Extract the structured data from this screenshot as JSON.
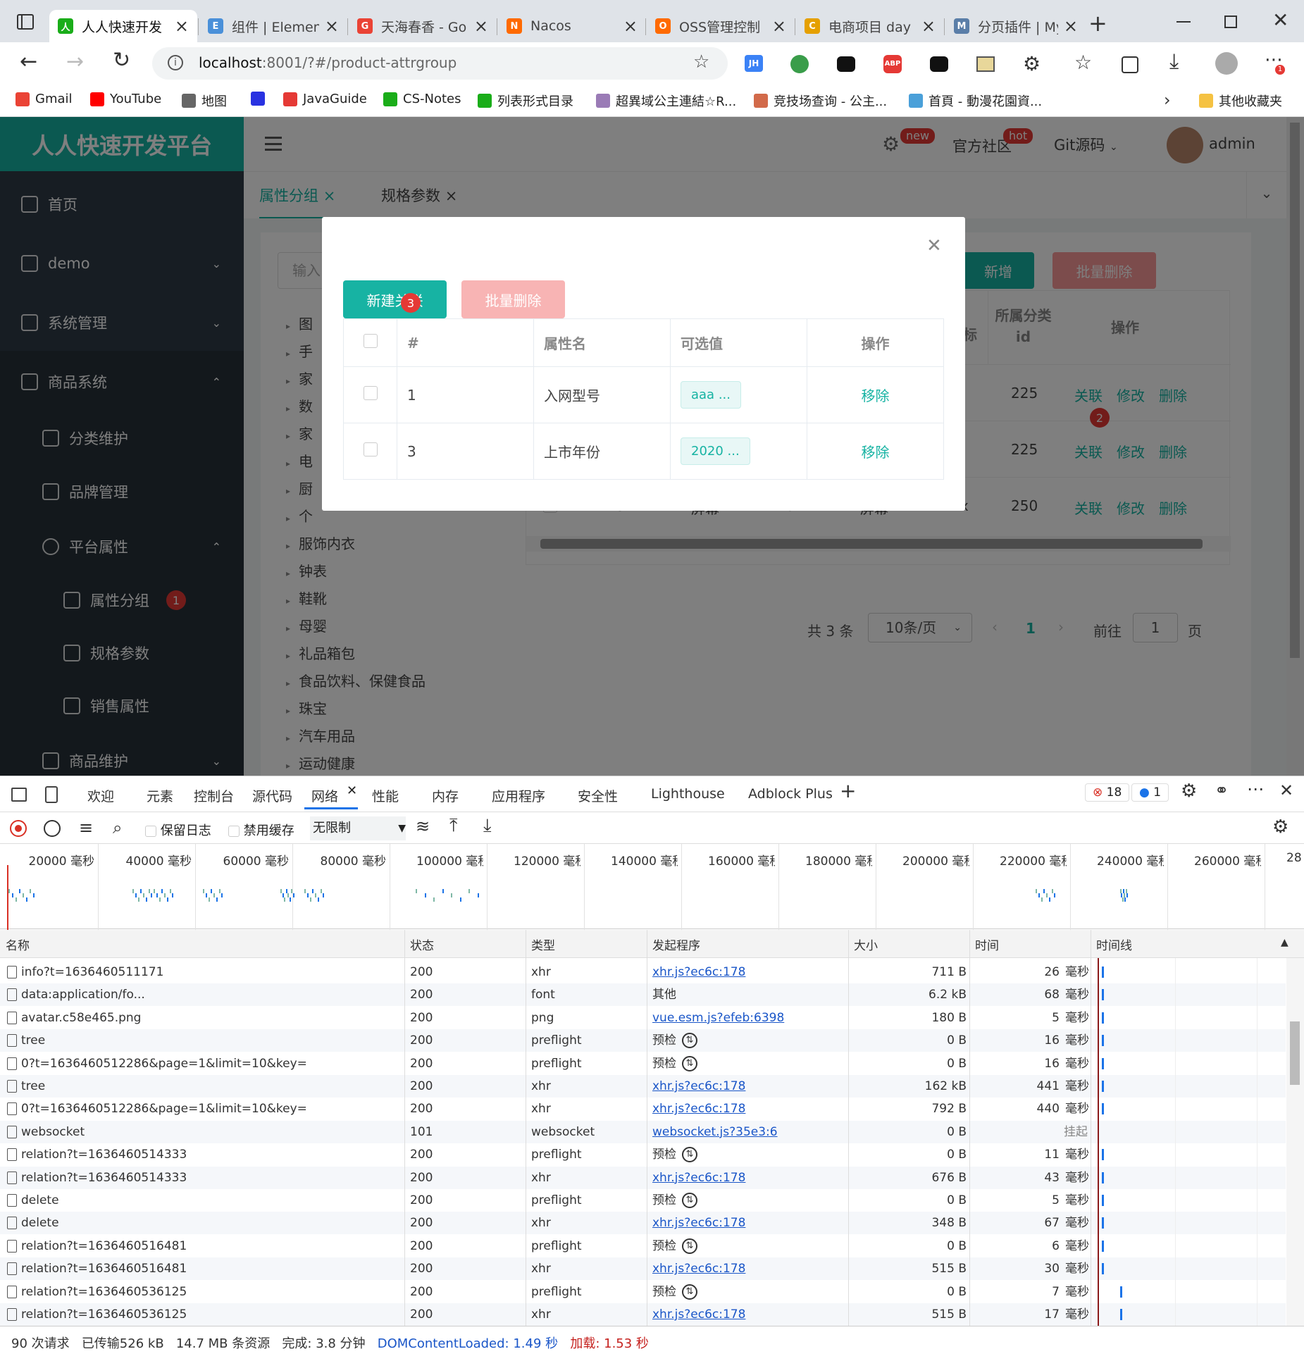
{
  "tabs": [
    {
      "label": "人人快速开发",
      "color": "#1aad19",
      "glyph": "人"
    },
    {
      "label": "组件 | Elemen",
      "color": "#4a90d9",
      "glyph": "E"
    },
    {
      "label": "天海春香 - Go",
      "color": "#ea4335",
      "glyph": "G"
    },
    {
      "label": "Nacos",
      "color": "#ff6a00",
      "glyph": "N"
    },
    {
      "label": "OSS管理控制",
      "color": "#ff6a00",
      "glyph": "O"
    },
    {
      "label": "电商项目 day",
      "color": "#e5a000",
      "glyph": "C"
    },
    {
      "label": "分页插件 | My",
      "color": "#5a7ea8",
      "glyph": "M"
    }
  ],
  "address": {
    "host": "localhost",
    "rest": ":8001/?#/product-attrgroup"
  },
  "bookmarks": [
    {
      "label": "Gmail",
      "color": "#ea4335"
    },
    {
      "label": "YouTube",
      "color": "#ff0000"
    },
    {
      "label": "地图",
      "color": "#666666"
    },
    {
      "label": "",
      "color": "#2932e1"
    },
    {
      "label": "JavaGuide",
      "color": "#e53935"
    },
    {
      "label": "CS-Notes",
      "color": "#1aad19"
    },
    {
      "label": "列表形式目录",
      "color": "#1aad19"
    },
    {
      "label": "超異域公主連結☆R...",
      "color": "#9a7bb6"
    },
    {
      "label": "竞技场查询 - 公主...",
      "color": "#d26a4a"
    },
    {
      "label": "首頁 - 動漫花園資...",
      "color": "#4aa0d9"
    }
  ],
  "bookmarks_other": "其他收藏夹",
  "app": {
    "logo": "人人快速开发平台",
    "header": {
      "new_badge": "new",
      "hot_badge": "hot",
      "community": "官方社区",
      "git": "Git源码",
      "user": "admin"
    },
    "menu": {
      "home": "首页",
      "demo": "demo",
      "sys": "系统管理",
      "product": "商品系统",
      "category": "分类维护",
      "brand": "品牌管理",
      "platform": "平台属性",
      "attrgroup": "属性分组",
      "spec": "规格参数",
      "sale": "销售属性",
      "goods": "商品维护"
    },
    "badge1": "1",
    "tabs": {
      "t1": "属性分组",
      "t2": "规格参数"
    },
    "search_placeholder": "输入",
    "buttons": {
      "add": "新增",
      "batch_delete": "批量删除"
    },
    "tree": [
      "图",
      "手",
      "家",
      "数",
      "家",
      "电",
      "厨",
      "个",
      "服饰内衣",
      "钟表",
      "鞋靴",
      "母婴",
      "礼品箱包",
      "食品饮料、保健食品",
      "珠宝",
      "汽车用品",
      "运动健康",
      "玩具乐器"
    ],
    "bg_table": {
      "headers": {
        "icon": "标",
        "catid": "所属分类\nid",
        "ops": "操作"
      },
      "rows": [
        {
          "catid": "225",
          "a": "关联",
          "b": "修改",
          "c": "删除"
        },
        {
          "catid": "225",
          "a": "关联",
          "b": "修改",
          "c": "删除"
        },
        {
          "id": "3",
          "name": "屏幕",
          "sort": "0",
          "desc": "屏幕",
          "icon": "xx",
          "catid": "250",
          "a": "关联",
          "b": "修改",
          "c": "删除"
        }
      ],
      "badge2": "2"
    },
    "pager": {
      "total": "共 3 条",
      "size": "10条/页",
      "page": "1",
      "goto": "前往",
      "goto_val": "1",
      "unit": "页"
    }
  },
  "modal": {
    "new_btn": "新建关联",
    "badge3": "3",
    "batch_btn": "批量删除",
    "headers": {
      "idx": "#",
      "name": "属性名",
      "values": "可选值",
      "ops": "操作"
    },
    "rows": [
      {
        "id": "1",
        "name": "入网型号",
        "value": "aaa ...",
        "op": "移除"
      },
      {
        "id": "3",
        "name": "上市年份",
        "value": "2020 ...",
        "op": "移除"
      }
    ]
  },
  "devtools": {
    "tabs": [
      "欢迎",
      "元素",
      "控制台",
      "源代码",
      "网络",
      "性能",
      "内存",
      "应用程序",
      "安全性",
      "Lighthouse",
      "Adblock Plus"
    ],
    "errors": "18",
    "messages": "1",
    "toolbar": {
      "preserve": "保留日志",
      "disable_cache": "禁用缓存",
      "throttle": "无限制"
    },
    "ticks": [
      "20000 毫秒",
      "40000 毫秒",
      "60000 毫秒",
      "80000 毫秒",
      "100000 毫秒",
      "120000 毫秒",
      "140000 毫秒",
      "160000 毫秒",
      "180000 毫秒",
      "200000 毫秒",
      "220000 毫秒",
      "240000 毫秒",
      "260000 毫秒",
      "28"
    ],
    "columns": {
      "name": "名称",
      "status": "状态",
      "type": "类型",
      "initiator": "发起程序",
      "size": "大小",
      "time": "时间",
      "waterfall": "时间线"
    },
    "rows": [
      {
        "name": "info?t=1636460511171",
        "status": "200",
        "type": "xhr",
        "init": "xhr.js?ec6c:178",
        "link": true,
        "size": "711 B",
        "time": "26",
        "unit": "毫秒"
      },
      {
        "name": "data:application/fo...",
        "status": "200",
        "type": "font",
        "init": "其他",
        "link": false,
        "size": "6.2 kB",
        "time": "68",
        "unit": "毫秒"
      },
      {
        "name": "avatar.c58e465.png",
        "status": "200",
        "type": "png",
        "init": "vue.esm.js?efeb:6398",
        "link": true,
        "size": "180 B",
        "time": "5",
        "unit": "毫秒"
      },
      {
        "name": "tree",
        "status": "200",
        "type": "preflight",
        "init": "预检",
        "link": false,
        "size": "0 B",
        "time": "16",
        "unit": "毫秒"
      },
      {
        "name": "0?t=1636460512286&page=1&limit=10&key=",
        "status": "200",
        "type": "preflight",
        "init": "预检",
        "link": false,
        "size": "0 B",
        "time": "16",
        "unit": "毫秒"
      },
      {
        "name": "tree",
        "status": "200",
        "type": "xhr",
        "init": "xhr.js?ec6c:178",
        "link": true,
        "size": "162 kB",
        "time": "441",
        "unit": "毫秒"
      },
      {
        "name": "0?t=1636460512286&page=1&limit=10&key=",
        "status": "200",
        "type": "xhr",
        "init": "xhr.js?ec6c:178",
        "link": true,
        "size": "792 B",
        "time": "440",
        "unit": "毫秒"
      },
      {
        "name": "websocket",
        "status": "101",
        "type": "websocket",
        "init": "websocket.js?35e3:6",
        "link": true,
        "size": "0 B",
        "time": "挂起",
        "unit": ""
      },
      {
        "name": "relation?t=1636460514333",
        "status": "200",
        "type": "preflight",
        "init": "预检",
        "link": false,
        "size": "0 B",
        "time": "11",
        "unit": "毫秒"
      },
      {
        "name": "relation?t=1636460514333",
        "status": "200",
        "type": "xhr",
        "init": "xhr.js?ec6c:178",
        "link": true,
        "size": "676 B",
        "time": "43",
        "unit": "毫秒"
      },
      {
        "name": "delete",
        "status": "200",
        "type": "preflight",
        "init": "预检",
        "link": false,
        "size": "0 B",
        "time": "5",
        "unit": "毫秒"
      },
      {
        "name": "delete",
        "status": "200",
        "type": "xhr",
        "init": "xhr.js?ec6c:178",
        "link": true,
        "size": "348 B",
        "time": "67",
        "unit": "毫秒"
      },
      {
        "name": "relation?t=1636460516481",
        "status": "200",
        "type": "preflight",
        "init": "预检",
        "link": false,
        "size": "0 B",
        "time": "6",
        "unit": "毫秒"
      },
      {
        "name": "relation?t=1636460516481",
        "status": "200",
        "type": "xhr",
        "init": "xhr.js?ec6c:178",
        "link": true,
        "size": "515 B",
        "time": "30",
        "unit": "毫秒"
      },
      {
        "name": "relation?t=1636460536125",
        "status": "200",
        "type": "preflight",
        "init": "预检",
        "link": false,
        "size": "0 B",
        "time": "7",
        "unit": "毫秒"
      },
      {
        "name": "relation?t=1636460536125",
        "status": "200",
        "type": "xhr",
        "init": "xhr.js?ec6c:178",
        "link": true,
        "size": "515 B",
        "time": "17",
        "unit": "毫秒"
      }
    ],
    "status_bar": {
      "req": "90 次请求",
      "transferred": "已传输526 kB",
      "resources": "14.7 MB 条资源",
      "finish": "完成: 3.8 分钟",
      "dcl": "DOMContentLoaded: 1.49 秒",
      "load": "加载: 1.53 秒"
    }
  }
}
